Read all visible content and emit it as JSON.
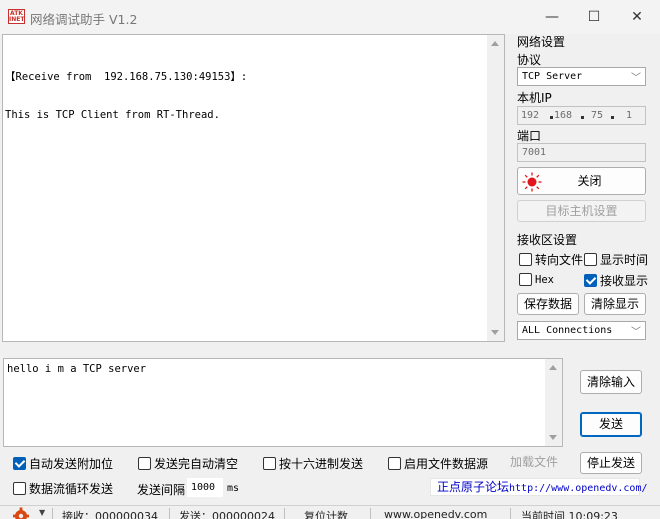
{
  "window": {
    "logo_top": "ATK",
    "logo_bottom": "INET",
    "title": "网络调试助手 V1.2",
    "minimize": "—",
    "maximize": "☐",
    "close": "✕"
  },
  "receive_area": {
    "lines": [
      "【Receive from  192.168.75.130:49153】:",
      "This is TCP Client from RT-Thread."
    ]
  },
  "send_area": {
    "text": "hello i m a TCP server"
  },
  "network_settings": {
    "title": "网络设置",
    "protocol_label": "协议",
    "protocol_value": "TCP Server",
    "local_ip_label": "本机IP",
    "ip": [
      "192",
      "168",
      "75",
      "1"
    ],
    "port_label": "端口",
    "port_value": "7001",
    "close_button": "关闭",
    "target_host_button": "目标主机设置"
  },
  "receive_settings": {
    "title": "接收区设置",
    "redirect_file": "转向文件",
    "show_time": "显示时间",
    "hex": "Hex",
    "show_receive": "接收显示",
    "save_data": "保存数据",
    "clear_display": "清除显示",
    "connections_value": "ALL Connections"
  },
  "send_controls": {
    "clear_input": "清除输入",
    "send": "发送",
    "stop_send": "停止发送"
  },
  "send_options": {
    "auto_append": "自动发送附加位",
    "clear_after_send": "发送完自动清空",
    "send_hex": "按十六进制发送",
    "enable_file_source": "启用文件数据源",
    "load_file": "加载文件",
    "loop_send": "数据流循环发送",
    "interval_label": "发送间隔",
    "interval_value": "1000",
    "interval_unit": "ms",
    "forum_text": "正点原子论坛",
    "forum_url": "http://www.openedv.com/"
  },
  "status_bar": {
    "receive": "接收：000000034",
    "send": "发送：000000024",
    "reset_count": "复位计数",
    "website": "www.openedv.com",
    "time": "当前时间 10:09:23"
  },
  "colors": {
    "accent": "#005fb8",
    "led_red": "#e0161c",
    "forum_blue": "#0000c8"
  }
}
